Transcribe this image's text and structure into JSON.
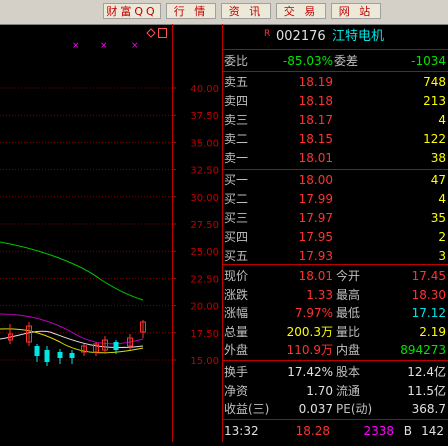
{
  "toolbar": {
    "buttons": [
      "财富QQ",
      "行 情",
      "资 讯",
      "交 易",
      "网 站"
    ]
  },
  "chart": {
    "price_ticks": [
      "40.00",
      "37.50",
      "35.00",
      "32.50",
      "30.00",
      "27.50",
      "25.00",
      "22.50",
      "20.00",
      "17.50",
      "15.00"
    ],
    "marker_icons": [
      "diamond-icon",
      "square-icon"
    ]
  },
  "stock": {
    "r_mark": "R",
    "code": "002176",
    "name": "江特电机"
  },
  "ratio": {
    "label1": "委比",
    "value1": "-85.03%",
    "label2": "委差",
    "value2": "-1034"
  },
  "sell": [
    {
      "label": "卖五",
      "price": "18.19",
      "volume": "748"
    },
    {
      "label": "卖四",
      "price": "18.18",
      "volume": "213"
    },
    {
      "label": "卖三",
      "price": "18.17",
      "volume": "4"
    },
    {
      "label": "卖二",
      "price": "18.15",
      "volume": "122"
    },
    {
      "label": "卖一",
      "price": "18.01",
      "volume": "38"
    }
  ],
  "buy": [
    {
      "label": "买一",
      "price": "18.00",
      "volume": "47"
    },
    {
      "label": "买二",
      "price": "17.99",
      "volume": "4"
    },
    {
      "label": "买三",
      "price": "17.97",
      "volume": "35"
    },
    {
      "label": "买四",
      "price": "17.95",
      "volume": "2"
    },
    {
      "label": "买五",
      "price": "17.93",
      "volume": "3"
    }
  ],
  "quote": [
    {
      "l1": "现价",
      "v1": "18.01",
      "l2": "今开",
      "v2": "17.45"
    },
    {
      "l1": "涨跌",
      "v1": "1.33",
      "l2": "最高",
      "v2": "18.30"
    },
    {
      "l1": "涨幅",
      "v1": "7.97%",
      "l2": "最低",
      "v2": "17.12"
    },
    {
      "l1": "总量",
      "v1": "200.3万",
      "l2": "量比",
      "v2": "2.19"
    },
    {
      "l1": "外盘",
      "v1": "110.9万",
      "l2": "内盘",
      "v2": "894273"
    }
  ],
  "fund": [
    {
      "l1": "换手",
      "v1": "17.42%",
      "l2": "股本",
      "v2": "12.4亿"
    },
    {
      "l1": "净资",
      "v1": "1.70",
      "l2": "流通",
      "v2": "11.5亿"
    },
    {
      "l1": "收益(三)",
      "v1": "0.037",
      "l2": "PE(动)",
      "v2": "368.7"
    }
  ],
  "tick_row": {
    "time": "13:32",
    "price": "18.28",
    "volume": "2338",
    "side": "B",
    "count": "142"
  },
  "colors": {
    "up": "#ff3232",
    "down": "#00e6e6",
    "volume_in": "#00e600",
    "accent": "#c00000"
  }
}
